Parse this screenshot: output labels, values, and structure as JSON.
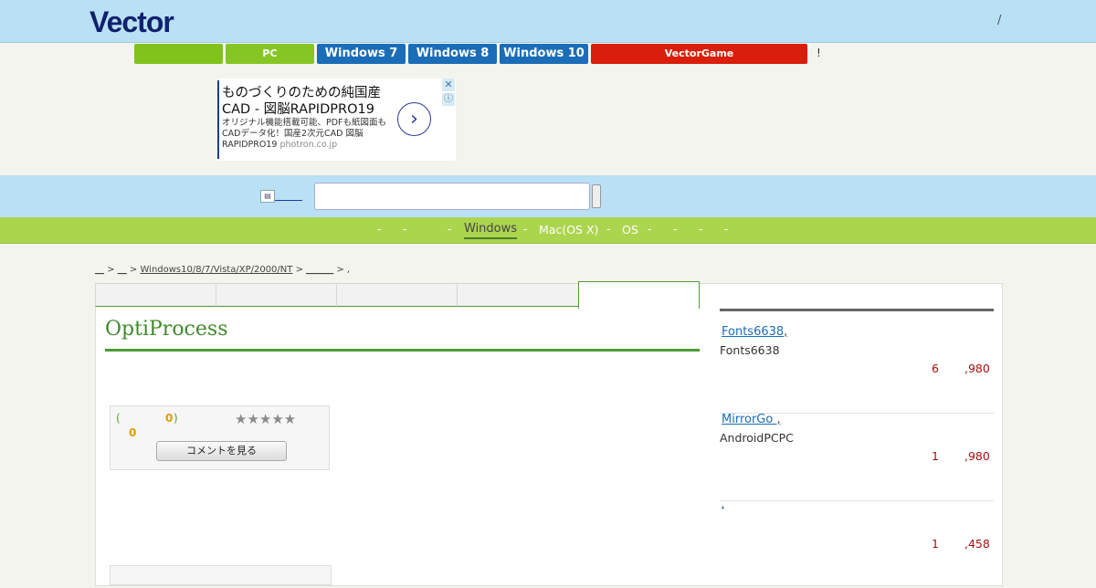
{
  "header": {
    "logo": "Vector",
    "right_text": "/"
  },
  "nav": {
    "buttons": [
      "",
      "PC",
      "Windows 7",
      "Windows 8",
      "Windows 10",
      "VectorGame"
    ],
    "suffix": "!"
  },
  "ad": {
    "title": "ものづくりのための純国産CAD - 図脳RAPIDPRO19",
    "desc": "オリジナル機能搭載可能、PDFも紙図面もCADデータ化！国産2次元CAD 図脳RAPIDPRO19",
    "domain": "photron.co.jp",
    "arrow": "›",
    "close": "✕",
    "info": "ⓘ"
  },
  "search": {
    "icon_text": "▤",
    "placeholder": ""
  },
  "categories": [
    "-",
    "-",
    "-",
    "Windows",
    "-",
    "Mac(OS X)",
    "-",
    "OS",
    "-",
    "-",
    "-",
    "-"
  ],
  "breadcrumb": {
    "p1": "__",
    "p2": "__",
    "p3": "Windows10/8/7/Vista/XP/2000/NT",
    "p4": "______",
    "p5": ","
  },
  "main": {
    "title": "OptiProcess",
    "rating": {
      "open": "(",
      "count": "0",
      "close": ")",
      "score": "0",
      "stars": "★★★★★"
    },
    "comment_button": "コメントを見る"
  },
  "sidebar": {
    "items": [
      {
        "name": "Fonts6638",
        "desc": "Fonts6638",
        "num1": "6",
        "num2": ",980"
      },
      {
        "name": "MirrorGo ",
        "desc": "AndroidPCPC",
        "num1": "1",
        "num2": ",980"
      },
      {
        "name": "",
        "desc": "",
        "num1": "1",
        "num2": ",458"
      }
    ]
  },
  "colors": {
    "header_bg": "#b9e0f4",
    "green": "#acd54e",
    "blue_btn": "#1a6db6",
    "red_btn": "#d91e0c",
    "title_green": "#3f8a2c"
  }
}
